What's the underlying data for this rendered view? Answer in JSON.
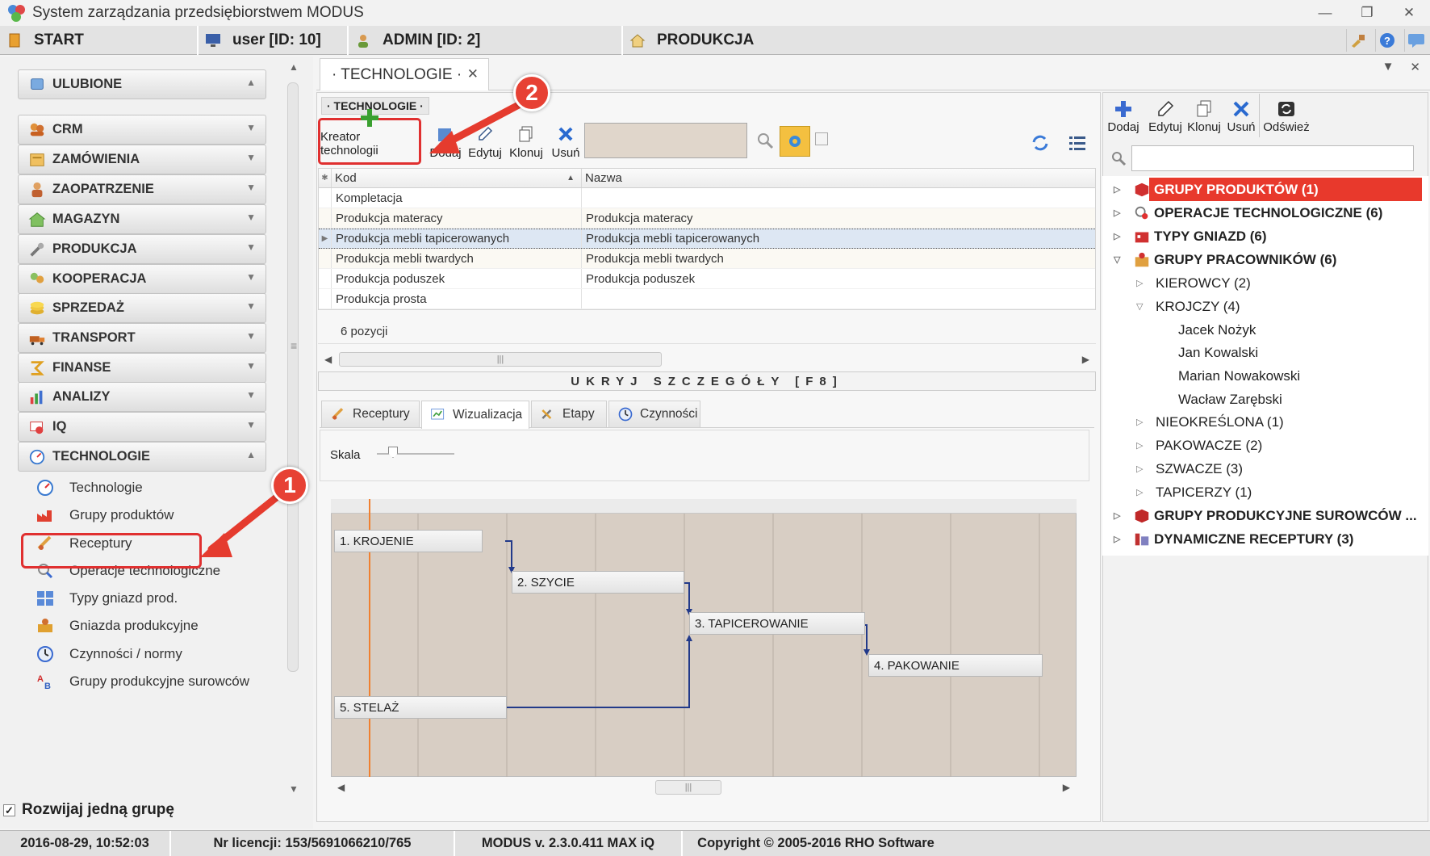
{
  "app": {
    "title": "System zarządzania przedsiębiorstwem MODUS",
    "window_buttons": [
      "—",
      "❐",
      "✕"
    ]
  },
  "topbar": {
    "start": "START",
    "user": "user [ID: 10]",
    "admin": "ADMIN [ID: 2]",
    "module": "PRODUKCJA"
  },
  "sidebar": {
    "groups": [
      {
        "label": "ULUBIONE",
        "icon": "star-icon"
      },
      {
        "label": "CRM",
        "icon": "crm-icon"
      },
      {
        "label": "ZAMÓWIENIA",
        "icon": "orders-icon"
      },
      {
        "label": "ZAOPATRZENIE",
        "icon": "supply-icon"
      },
      {
        "label": "MAGAZYN",
        "icon": "warehouse-icon"
      },
      {
        "label": "PRODUKCJA",
        "icon": "production-icon"
      },
      {
        "label": "KOOPERACJA",
        "icon": "cooperation-icon"
      },
      {
        "label": "SPRZEDAŻ",
        "icon": "sales-icon"
      },
      {
        "label": "TRANSPORT",
        "icon": "truck-icon"
      },
      {
        "label": "FINANSE",
        "icon": "finance-icon"
      },
      {
        "label": "ANALIZY",
        "icon": "analytics-icon"
      },
      {
        "label": "IQ",
        "icon": "iq-icon"
      },
      {
        "label": "TECHNOLOGIE",
        "icon": "technology-icon"
      }
    ],
    "sub_items": [
      {
        "label": "Technologie",
        "icon": "gauge-icon"
      },
      {
        "label": "Grupy produktów",
        "icon": "factory-icon"
      },
      {
        "label": "Receptury",
        "icon": "recipe-icon"
      },
      {
        "label": "Operacje technologiczne",
        "icon": "operations-icon"
      },
      {
        "label": "Typy gniazd prod.",
        "icon": "grid-icon"
      },
      {
        "label": "Gniazda produkcyjne",
        "icon": "workstation-icon"
      },
      {
        "label": "Czynności / normy",
        "icon": "clock-icon"
      },
      {
        "label": "Grupy produkcyjne surowców",
        "icon": "materials-icon"
      }
    ],
    "expand_one_group": "Rozwijaj jedną grupę",
    "expand_checked": "✓"
  },
  "tab": {
    "label": "· TECHNOLOGIE ·",
    "close": "✕"
  },
  "section_label": "· TECHNOLOGIE ·",
  "toolbar": {
    "kreator": "Kreator technologii",
    "dodaj": "Dodaj",
    "edytuj": "Edytuj",
    "klonuj": "Klonuj",
    "usun": "Usuń",
    "search_value": ""
  },
  "grid": {
    "columns": [
      "Kod",
      "Nazwa"
    ],
    "rows": [
      {
        "kod": "Kompletacja",
        "nazwa": ""
      },
      {
        "kod": "Produkcja materacy",
        "nazwa": "Produkcja materacy"
      },
      {
        "kod": "Produkcja mebli tapicerowanych",
        "nazwa": "Produkcja mebli tapicerowanych"
      },
      {
        "kod": "Produkcja mebli twardych",
        "nazwa": "Produkcja mebli twardych"
      },
      {
        "kod": "Produkcja poduszek",
        "nazwa": "Produkcja poduszek"
      },
      {
        "kod": "Produkcja prosta",
        "nazwa": ""
      }
    ],
    "count": "6 pozycji"
  },
  "ukryj": "UKRYJ SZCZEGÓŁY [F8]",
  "subtabs": [
    {
      "label": "Receptury",
      "icon": "recipe-icon"
    },
    {
      "label": "Wizualizacja",
      "icon": "chart-icon"
    },
    {
      "label": "Etapy",
      "icon": "tools-icon"
    },
    {
      "label": "Czynności",
      "icon": "clock-icon"
    }
  ],
  "skala": "Skala",
  "gantt": {
    "bars": [
      "1. KROJENIE",
      "2. SZYCIE",
      "3. TAPICEROWANIE",
      "4. PAKOWANIE",
      "5. STELAŻ"
    ]
  },
  "right": {
    "buttons": [
      "Dodaj",
      "Edytuj",
      "Klonuj",
      "Usuń",
      "Odśwież"
    ],
    "tree": [
      {
        "label": "GRUPY PRODUKTÓW (1)"
      },
      {
        "label": "OPERACJE TECHNOLOGICZNE (6)"
      },
      {
        "label": "TYPY GNIAZD (6)"
      },
      {
        "label": "GRUPY PRACOWNIKÓW (6)"
      },
      {
        "label": "KIEROWCY (2)"
      },
      {
        "label": "KROJCZY (4)"
      },
      {
        "label": "Jacek Nożyk"
      },
      {
        "label": "Jan Kowalski"
      },
      {
        "label": "Marian Nowakowski"
      },
      {
        "label": "Wacław Zarębski"
      },
      {
        "label": "NIEOKREŚLONA (1)"
      },
      {
        "label": "PAKOWACZE (2)"
      },
      {
        "label": "SZWACZE (3)"
      },
      {
        "label": "TAPICERZY (1)"
      },
      {
        "label": "GRUPY PRODUKCYJNE SUROWCÓW ..."
      },
      {
        "label": "DYNAMICZNE RECEPTURY (3)"
      }
    ]
  },
  "status": {
    "datetime": "2016-08-29, 10:52:03",
    "license": "Nr licencji: 153/5691066210/765",
    "version": "MODUS v. 2.3.0.411 MAX iQ",
    "copyright": "Copyright © 2005-2016 RHO Software"
  },
  "callouts": [
    "1",
    "2"
  ],
  "colors": {
    "accent_red": "#e03030",
    "tree_selection": "#e8392c",
    "gantt_bg": "#d8cec4",
    "today_line": "#f08030"
  }
}
